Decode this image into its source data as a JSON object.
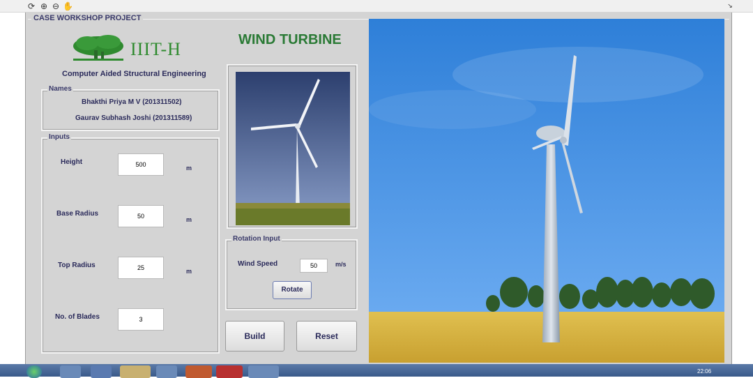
{
  "toolbar": {
    "icons": [
      "rotate-icon",
      "zoom-in-icon",
      "zoom-out-icon",
      "pan-hand-icon"
    ]
  },
  "window": {
    "title": "CASE WORKSHOP PROJECT"
  },
  "header": {
    "logo_text": "IIIT-H",
    "subtitle": "Computer Aided Structural Engineering",
    "title": "WIND TURBINE"
  },
  "names": {
    "label": "Names",
    "people": [
      "Bhakthi Priya M V (201311502)",
      "Gaurav Subhash Joshi (201311589)"
    ]
  },
  "inputs": {
    "label": "Inputs",
    "height": {
      "label": "Height",
      "value": "500",
      "unit": "m"
    },
    "base_radius": {
      "label": "Base Radius",
      "value": "50",
      "unit": "m"
    },
    "top_radius": {
      "label": "Top Radius",
      "value": "25",
      "unit": "m"
    },
    "blades": {
      "label": "No. of Blades",
      "value": "3"
    }
  },
  "rotation": {
    "label": "Rotation Input",
    "wind_speed_label": "Wind Speed",
    "wind_speed_value": "50",
    "wind_speed_unit": "m/s",
    "rotate_label": "Rotate"
  },
  "actions": {
    "build_label": "Build",
    "reset_label": "Reset"
  },
  "taskbar": {
    "clock": "22:06"
  },
  "colors": {
    "title_green": "#2a7a35",
    "label_navy": "#2a2a5a",
    "sky": "#4a90e0",
    "field": "#d8b040"
  }
}
